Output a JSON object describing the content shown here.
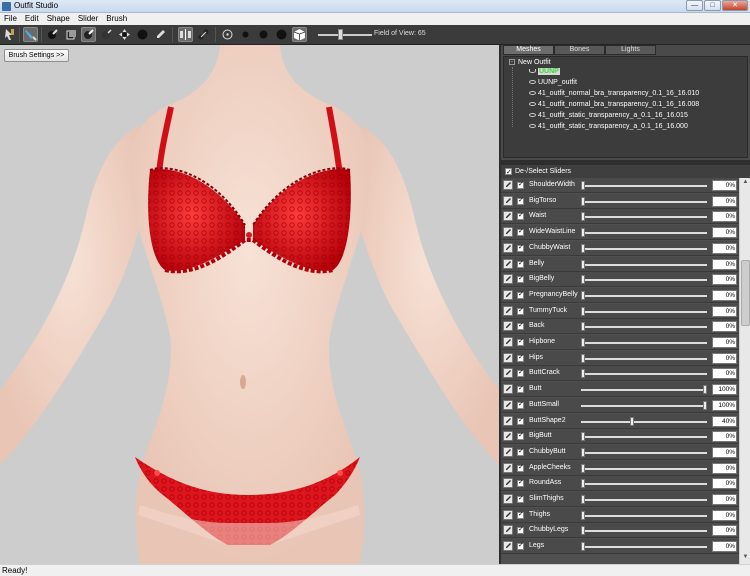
{
  "window": {
    "title": "Outfit Studio",
    "min": "—",
    "max": "□",
    "close": "✕"
  },
  "menu": [
    "File",
    "Edit",
    "Shape",
    "Slider",
    "Brush"
  ],
  "toolbar": {
    "fov_label": "Field of View: 65",
    "fov_value": 65
  },
  "viewport": {
    "brush_settings_label": "Brush Settings >>"
  },
  "tabs": [
    "Meshes",
    "Bones",
    "Lights"
  ],
  "tree": {
    "root": "New Outfit",
    "items": [
      "UUNP",
      "UUNP_outfit",
      "41_outfit_normal_bra_transparency_0.1_16_16.010",
      "41_outfit_normal_bra_transparency_0.1_16_16.008",
      "41_outfit_static_transparency_a_0.1_16_16.015",
      "41_outfit_static_transparency_a_0.1_16_16.000"
    ]
  },
  "sliders_header": "De-/Select Sliders",
  "sliders": [
    {
      "name": "ShoulderWidth",
      "value": "0%",
      "pos": 0
    },
    {
      "name": "BigTorso",
      "value": "0%",
      "pos": 0
    },
    {
      "name": "Waist",
      "value": "0%",
      "pos": 0
    },
    {
      "name": "WideWaistLine",
      "value": "0%",
      "pos": 0
    },
    {
      "name": "ChubbyWaist",
      "value": "0%",
      "pos": 0
    },
    {
      "name": "Belly",
      "value": "0%",
      "pos": 0
    },
    {
      "name": "BigBelly",
      "value": "0%",
      "pos": 0
    },
    {
      "name": "PregnancyBelly",
      "value": "0%",
      "pos": 0
    },
    {
      "name": "TummyTuck",
      "value": "0%",
      "pos": 0
    },
    {
      "name": "Back",
      "value": "0%",
      "pos": 0
    },
    {
      "name": "Hipbone",
      "value": "0%",
      "pos": 0
    },
    {
      "name": "Hips",
      "value": "0%",
      "pos": 0
    },
    {
      "name": "ButtCrack",
      "value": "0%",
      "pos": 0
    },
    {
      "name": "Butt",
      "value": "100%",
      "pos": 100
    },
    {
      "name": "ButtSmall",
      "value": "100%",
      "pos": 100
    },
    {
      "name": "ButtShape2",
      "value": "40%",
      "pos": 40
    },
    {
      "name": "BigButt",
      "value": "0%",
      "pos": 0
    },
    {
      "name": "ChubbyButt",
      "value": "0%",
      "pos": 0
    },
    {
      "name": "AppleCheeks",
      "value": "0%",
      "pos": 0
    },
    {
      "name": "RoundAss",
      "value": "0%",
      "pos": 0
    },
    {
      "name": "SlimThighs",
      "value": "0%",
      "pos": 0
    },
    {
      "name": "Thighs",
      "value": "0%",
      "pos": 0
    },
    {
      "name": "ChubbyLegs",
      "value": "0%",
      "pos": 0
    },
    {
      "name": "Legs",
      "value": "0%",
      "pos": 0
    }
  ],
  "status": "Ready!",
  "colors": {
    "skin": "#f4d9cc",
    "garment": "#e0141c",
    "viewport_bg": "#cdcdcd",
    "panel": "#4a4a4a",
    "selected_mesh": "#3fd43f"
  }
}
